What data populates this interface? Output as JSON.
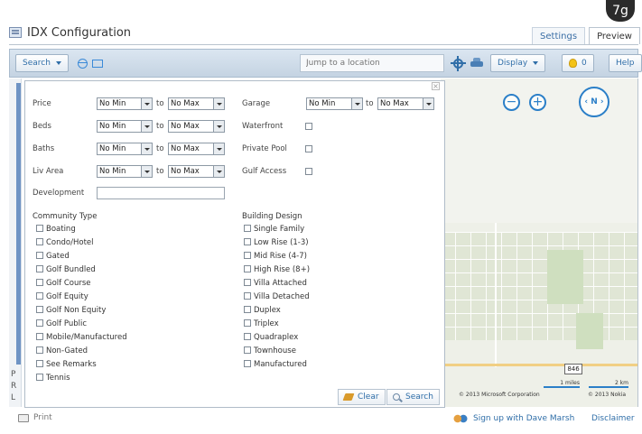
{
  "badge": "7g",
  "header": {
    "title": "IDX Configuration",
    "tabs": [
      "Settings",
      "Preview"
    ],
    "active_tab": "Preview"
  },
  "toolbar": {
    "search_label": "Search",
    "jump_placeholder": "Jump to a location",
    "display_label": "Display",
    "bulb_count": "0",
    "help_label": "Help"
  },
  "left_strip": [
    "P",
    "R",
    "L"
  ],
  "panel": {
    "to_label": "to",
    "fields": {
      "price": {
        "label": "Price",
        "min": "No Min",
        "max": "No Max"
      },
      "beds": {
        "label": "Beds",
        "min": "No Min",
        "max": "No Max"
      },
      "baths": {
        "label": "Baths",
        "min": "No Min",
        "max": "No Max"
      },
      "liv_area": {
        "label": "Liv Area",
        "min": "No Min",
        "max": "No Max"
      },
      "garage": {
        "label": "Garage",
        "min": "No Min",
        "max": "No Max"
      }
    },
    "checks": {
      "waterfront": "Waterfront",
      "private_pool": "Private Pool",
      "gulf_access": "Gulf Access"
    },
    "development_label": "Development",
    "community_type": {
      "title": "Community Type",
      "items": [
        "Boating",
        "Condo/Hotel",
        "Gated",
        "Golf Bundled",
        "Golf Course",
        "Golf Equity",
        "Golf Non Equity",
        "Golf Public",
        "Mobile/Manufactured",
        "Non-Gated",
        "See Remarks",
        "Tennis"
      ]
    },
    "building_design": {
      "title": "Building Design",
      "items": [
        "Single Family",
        "Low Rise (1-3)",
        "Mid Rise (4-7)",
        "High Rise (8+)",
        "Villa Attached",
        "Villa Detached",
        "Duplex",
        "Triplex",
        "Quadraplex",
        "Townhouse",
        "Manufactured"
      ]
    },
    "clear_label": "Clear",
    "search_label": "Search"
  },
  "map": {
    "compass_label": "N",
    "route": "846",
    "scale_miles": "1 miles",
    "scale_km": "2 km",
    "copyright_ms": "© 2013 Microsoft Corporation",
    "copyright_nokia": "© 2013 Nokia"
  },
  "footer": {
    "print_label": "Print",
    "signup_label": "Sign up with Dave Marsh",
    "disclaimer_label": "Disclaimer"
  }
}
